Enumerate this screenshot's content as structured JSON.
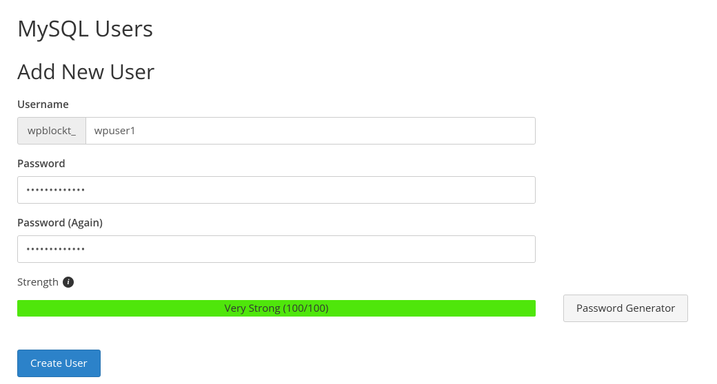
{
  "section": {
    "title": "MySQL Users",
    "subtitle": "Add New User"
  },
  "form": {
    "username": {
      "label": "Username",
      "prefix": "wpblockt_",
      "value": "wpuser1"
    },
    "password": {
      "label": "Password",
      "value": "•••••••••••••"
    },
    "password_again": {
      "label": "Password (Again)",
      "value": "•••••••••••••"
    },
    "strength": {
      "label": "Strength",
      "bar_text": "Very Strong (100/100)"
    },
    "generator_button": "Password Generator",
    "submit_button": "Create User"
  }
}
